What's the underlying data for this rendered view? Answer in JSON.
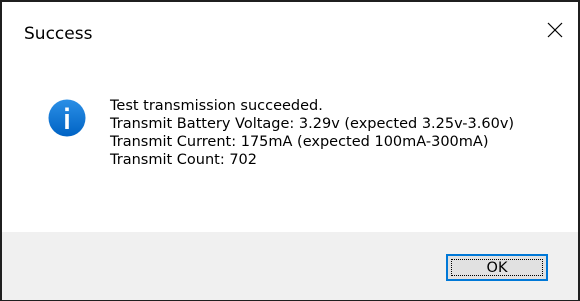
{
  "dialog": {
    "title": "Success",
    "close_icon": "close-icon",
    "icon": "information-icon",
    "accent_color": "#0078d7",
    "message_heading": "Test transmission succeeded.",
    "details": [
      "Transmit Battery Voltage: 3.29v (expected 3.25v-3.60v)",
      "Transmit Current: 175mA (expected 100mA-300mA)",
      "Transmit Count: 702"
    ],
    "ok_label": "OK"
  }
}
